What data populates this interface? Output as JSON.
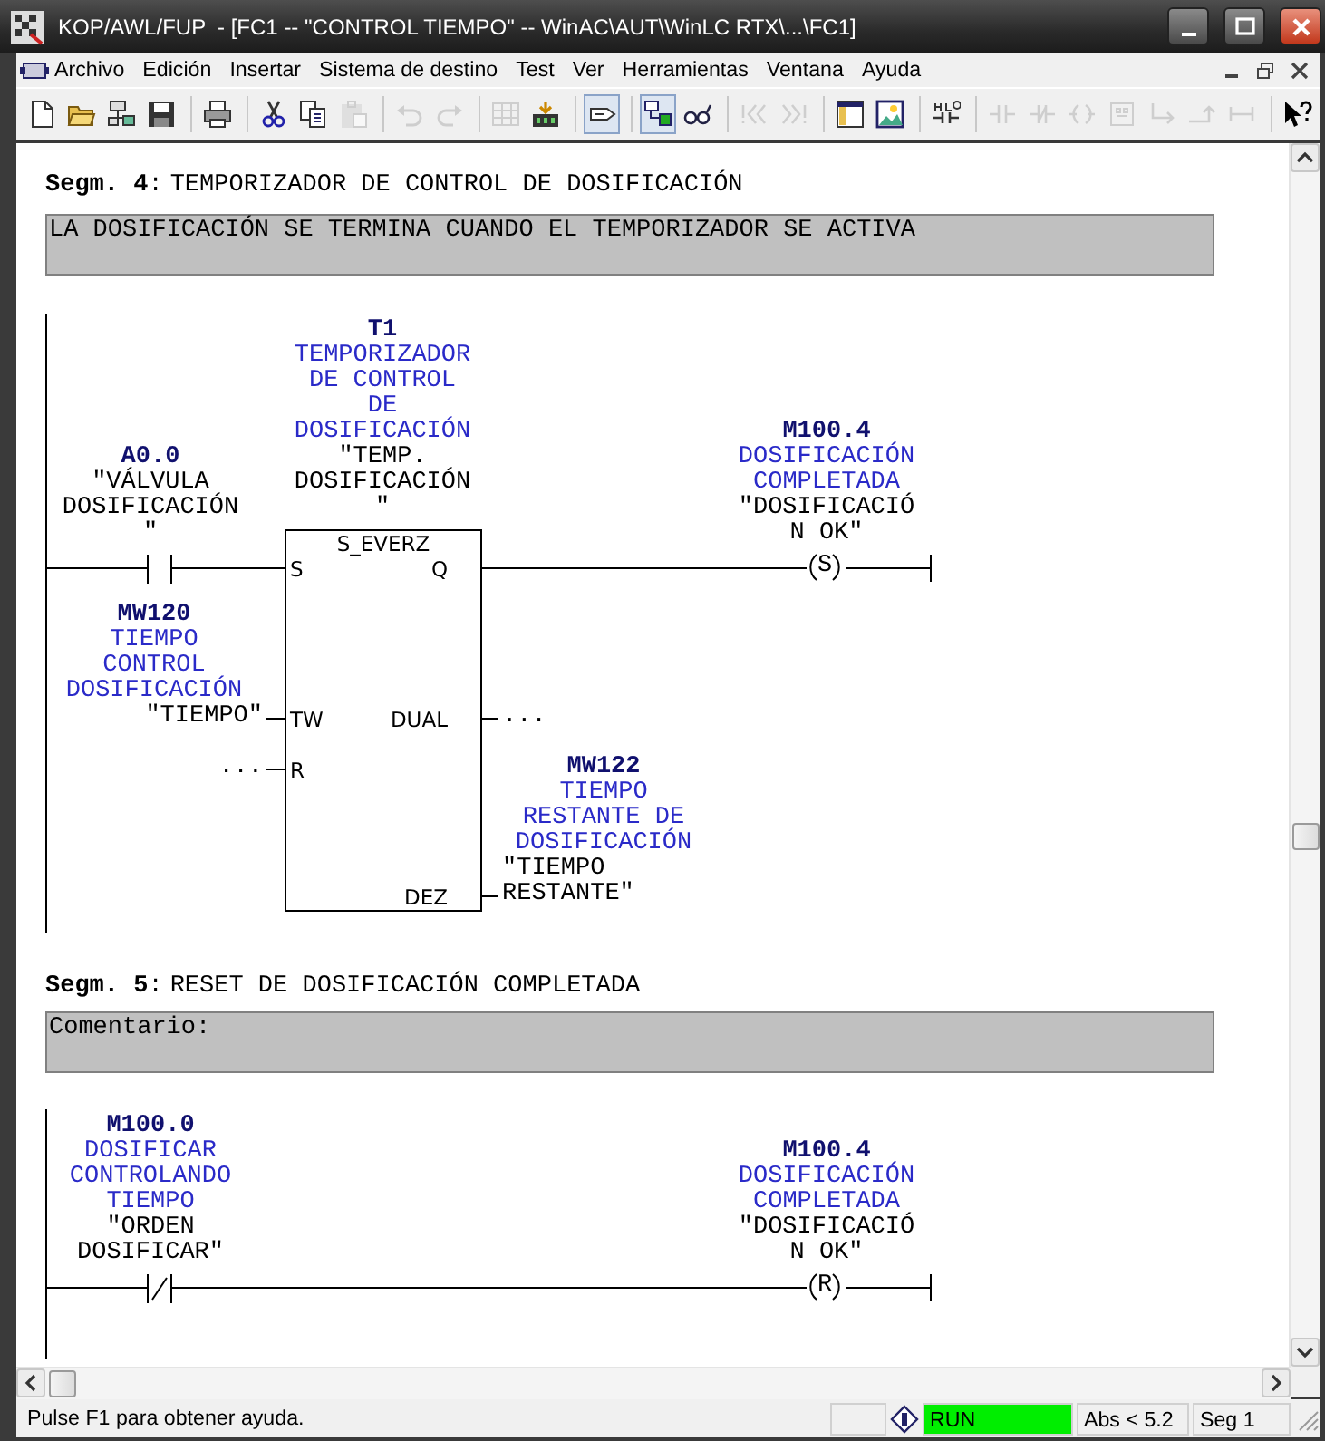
{
  "window": {
    "title": "KOP/AWL/FUP  - [FC1 -- \"CONTROL TIEMPO\" -- WinAC\\AUT\\WinLC RTX\\...\\FC1]"
  },
  "menu": [
    "Archivo",
    "Edición",
    "Insertar",
    "Sistema de destino",
    "Test",
    "Ver",
    "Herramientas",
    "Ventana",
    "Ayuda"
  ],
  "toolbar": [
    {
      "kind": "new",
      "disabled": false,
      "pressed": false
    },
    {
      "kind": "open",
      "disabled": false,
      "pressed": false
    },
    {
      "kind": "network",
      "disabled": false,
      "pressed": false
    },
    {
      "kind": "save",
      "disabled": false,
      "pressed": false
    },
    {
      "kind": "separator"
    },
    {
      "kind": "print",
      "disabled": false,
      "pressed": false
    },
    {
      "kind": "separator"
    },
    {
      "kind": "cut",
      "disabled": false,
      "pressed": false
    },
    {
      "kind": "copy",
      "disabled": false,
      "pressed": false
    },
    {
      "kind": "paste",
      "disabled": true,
      "pressed": false
    },
    {
      "kind": "separator"
    },
    {
      "kind": "undo",
      "disabled": true,
      "pressed": false
    },
    {
      "kind": "redo",
      "disabled": true,
      "pressed": false
    },
    {
      "kind": "separator"
    },
    {
      "kind": "compile",
      "disabled": true,
      "pressed": false
    },
    {
      "kind": "download",
      "disabled": false,
      "pressed": false
    },
    {
      "kind": "separator"
    },
    {
      "kind": "comment",
      "disabled": false,
      "pressed": true
    },
    {
      "kind": "separator"
    },
    {
      "kind": "connection",
      "disabled": false,
      "pressed": true
    },
    {
      "kind": "glasses",
      "disabled": false,
      "pressed": false
    },
    {
      "kind": "separator"
    },
    {
      "kind": "previous",
      "disabled": true,
      "pressed": false
    },
    {
      "kind": "next",
      "disabled": true,
      "pressed": false
    },
    {
      "kind": "separator"
    },
    {
      "kind": "window",
      "disabled": false,
      "pressed": false
    },
    {
      "kind": "image",
      "disabled": false,
      "pressed": false
    },
    {
      "kind": "separator"
    },
    {
      "kind": "ladder",
      "disabled": false,
      "pressed": false
    },
    {
      "kind": "separator"
    },
    {
      "kind": "contact",
      "disabled": true,
      "pressed": false
    },
    {
      "kind": "negated",
      "disabled": true,
      "pressed": false
    },
    {
      "kind": "coil",
      "disabled": true,
      "pressed": false
    },
    {
      "kind": "box",
      "disabled": true,
      "pressed": false
    },
    {
      "kind": "branch",
      "disabled": true,
      "pressed": false
    },
    {
      "kind": "join",
      "disabled": true,
      "pressed": false
    },
    {
      "kind": "connector",
      "disabled": true,
      "pressed": false
    },
    {
      "kind": "separator"
    },
    {
      "kind": "help",
      "disabled": false,
      "pressed": false
    }
  ],
  "networks": [
    {
      "label": "Segm. 4",
      "label_suffix": ":",
      "title": "TEMPORIZADOR DE CONTROL DE DOSIFICACIÓN",
      "comment": "LA DOSIFICACIÓN SE TERMINA CUANDO EL TEMPORIZADOR SE ACTIVA",
      "elements": [
        {
          "kind": "contact",
          "negated": false,
          "address": "A0.0",
          "symbol": "\"VÁLVULA DOSIFICACIÓN\""
        },
        {
          "kind": "box",
          "type": "S_EVERZ",
          "address": "T1",
          "comment": "TEMPORIZADOR DE CONTROL DE DOSIFICACIÓN",
          "symbol": "\"TEMP. DOSIFICACIÓN\"",
          "inputs": [
            {
              "pin": "S"
            },
            {
              "pin": "TW",
              "address": "MW120",
              "comment": "TIEMPO CONTROL DOSIFICACIÓN",
              "symbol": "\"TIEMPO\""
            },
            {
              "pin": "R",
              "symbol": "..."
            }
          ],
          "outputs": [
            {
              "pin": "Q"
            },
            {
              "pin": "DUAL",
              "symbol": "..."
            },
            {
              "pin": "DEZ",
              "address": "MW122",
              "comment": "TIEMPO RESTANTE DE DOSIFICACIÓN",
              "symbol": "\"TIEMPO RESTANTE\""
            }
          ]
        },
        {
          "kind": "coil",
          "operation": "S",
          "address": "M100.4",
          "comment": "DOSIFICACIÓN COMPLETADA",
          "symbol": "\"DOSIFICACIÓN OK\""
        }
      ]
    },
    {
      "label": "Segm. 5",
      "label_suffix": ":",
      "title": "RESET DE DOSIFICACIÓN COMPLETADA",
      "comment": "Comentario:",
      "elements": [
        {
          "kind": "contact",
          "negated": true,
          "address": "M100.0",
          "comment": "DOSIFICAR CONTROLANDO TIEMPO",
          "symbol": "\"ORDEN DOSIFICAR\""
        },
        {
          "kind": "coil",
          "operation": "R",
          "address": "M100.4",
          "comment": "DOSIFICACIÓN COMPLETADA",
          "symbol": "\"DOSIFICACIÓN OK\""
        }
      ]
    }
  ],
  "status_bar": {
    "message": "Pulse F1 para obtener ayuda.",
    "mode": "RUN",
    "position": "Abs < 5.2",
    "segment": "Seg 1"
  }
}
